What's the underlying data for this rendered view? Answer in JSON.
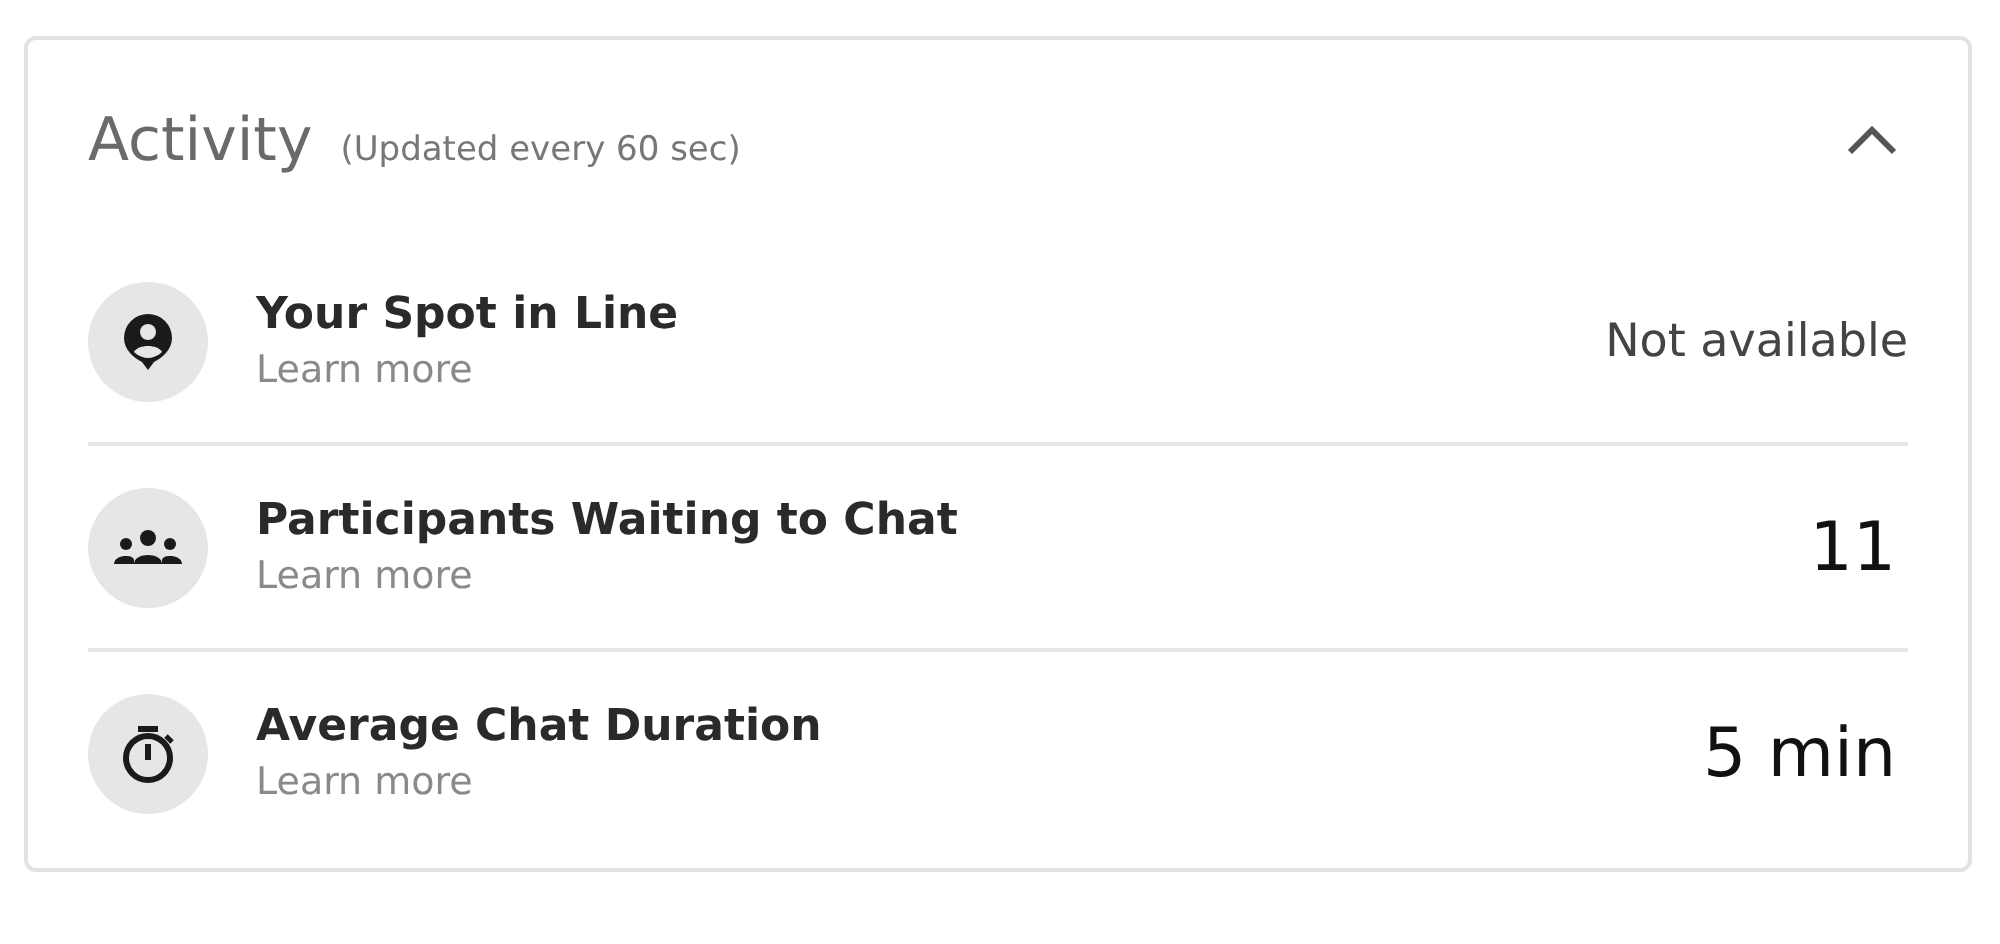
{
  "panel": {
    "title": "Activity",
    "subtitle": "(Updated every 60 sec)",
    "expanded": true
  },
  "rows": [
    {
      "kind": "position",
      "title": "Your Spot in Line",
      "link": "Learn more",
      "value": "Not available",
      "available": false
    },
    {
      "kind": "queue",
      "title": "Participants Waiting to Chat",
      "link": "Learn more",
      "value": "11",
      "available": true
    },
    {
      "kind": "duration",
      "title": "Average Chat Duration",
      "link": "Learn more",
      "value": "5 min",
      "available": true
    }
  ]
}
